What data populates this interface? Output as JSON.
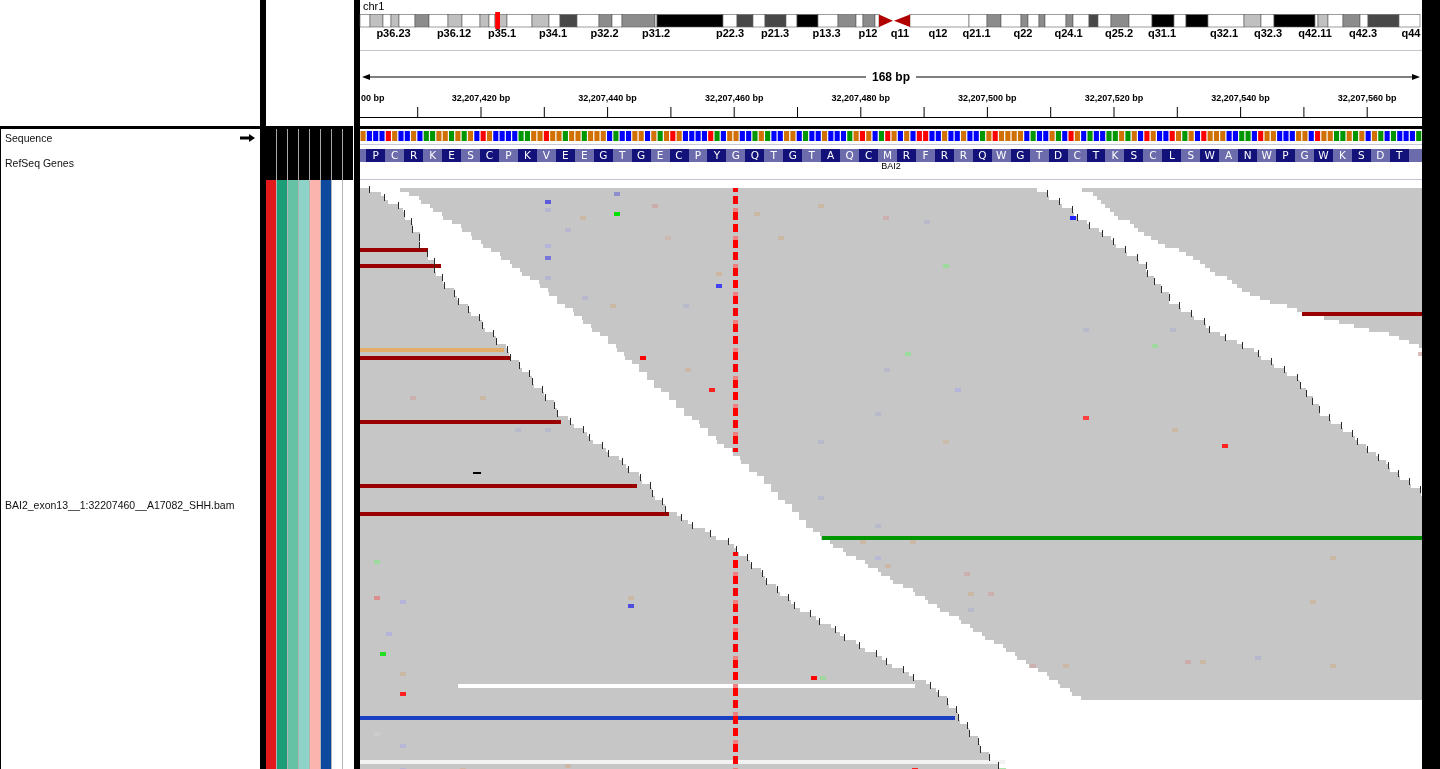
{
  "track_names": [
    {
      "label": "Sequence",
      "kind": "sequence",
      "forward_strand": true
    },
    {
      "label": "RefSeq Genes",
      "kind": "genes"
    },
    {
      "label": "BAI2_exon13__1:32207460__A17082_SHH.bam",
      "kind": "alignments"
    }
  ],
  "attribute_columns": [
    {
      "color": "#e31a1c"
    },
    {
      "color": "#1b9e77"
    },
    {
      "color": "#66c2a5"
    },
    {
      "color": "#8dd3c7"
    },
    {
      "color": "#fbb4ae"
    },
    {
      "color": "#0d4a9e"
    },
    {
      "color": "#ffffff"
    },
    {
      "color": "#ffffff"
    }
  ],
  "chromosome": {
    "name": "chr1",
    "cytobands": [
      "p36.23",
      "p36.12",
      "p35.1",
      "p34.1",
      "p32.2",
      "p31.2",
      "p22.3",
      "p21.3",
      "p13.3",
      "p12",
      "q11",
      "q12",
      "q21.1",
      "q22",
      "q24.1",
      "q25.2",
      "q31.1",
      "q32.1",
      "q32.3",
      "q42.11",
      "q42.3",
      "q44"
    ]
  },
  "ruler": {
    "span": "168 bp",
    "tick_labels": [
      "00 bp",
      "32,207,420 bp",
      "32,207,440 bp",
      "32,207,460 bp",
      "32,207,480 bp",
      "32,207,500 bp",
      "32,207,520 bp",
      "32,207,540 bp",
      "32,207,560 bp"
    ]
  },
  "gene_track": {
    "amino_acids": [
      "P",
      "C",
      "R",
      "K",
      "E",
      "S",
      "C",
      "P",
      "K",
      "V",
      "E",
      "E",
      "G",
      "T",
      "G",
      "E",
      "C",
      "P",
      "Y",
      "G",
      "Q",
      "T",
      "G",
      "T",
      "A",
      "Q",
      "C",
      "M",
      "R",
      "F",
      "R",
      "R",
      "Q",
      "W",
      "G",
      "T",
      "D",
      "C",
      "T",
      "K",
      "S",
      "C",
      "L",
      "S",
      "W",
      "A",
      "N",
      "W",
      "P",
      "G",
      "W",
      "K",
      "S",
      "D",
      "T"
    ],
    "gene_name": "BAI2"
  }
}
